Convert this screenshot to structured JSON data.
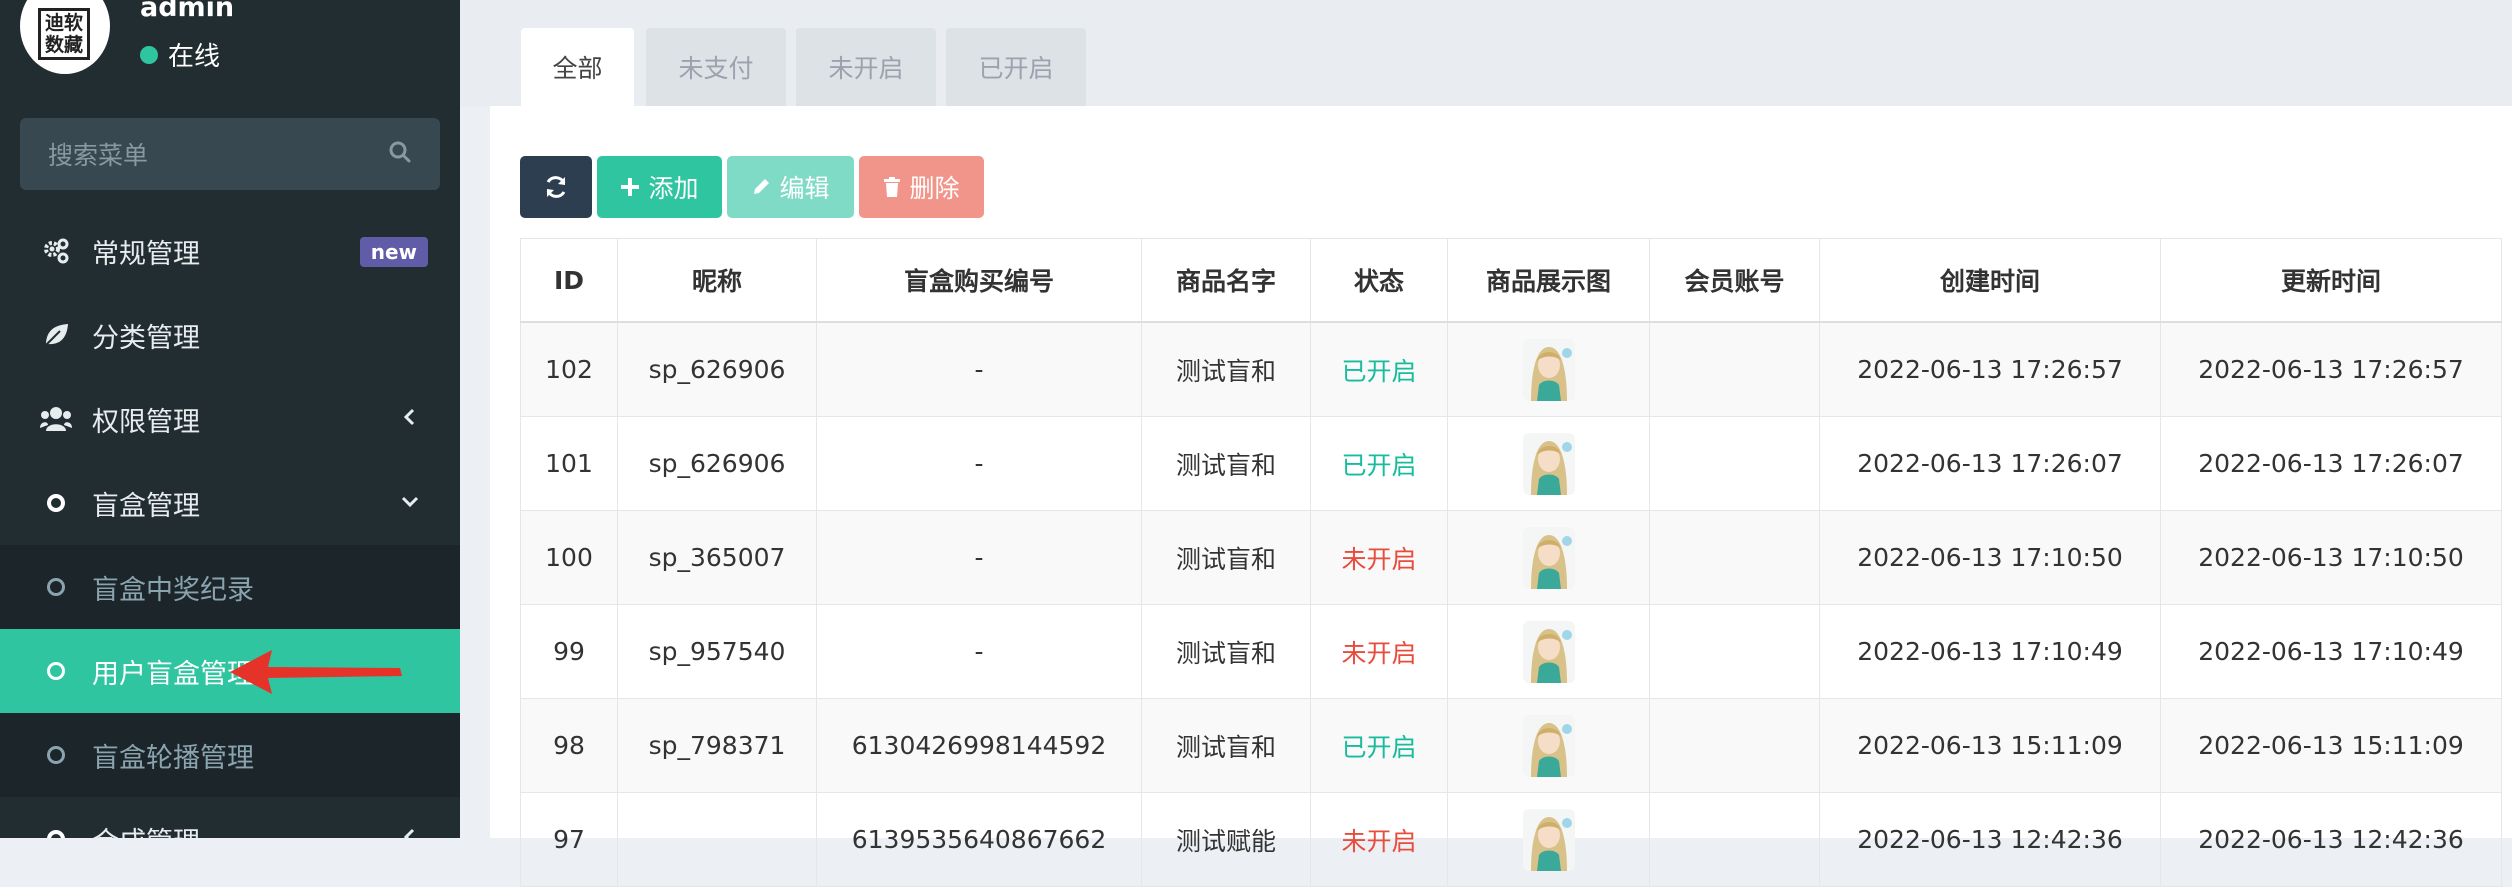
{
  "user": {
    "name": "admin",
    "status": "在线",
    "logo_text": "迪软数藏"
  },
  "search": {
    "placeholder": "搜索菜单"
  },
  "menu": [
    {
      "label": "常规管理",
      "icon": "gears-icon",
      "badge": "new"
    },
    {
      "label": "分类管理",
      "icon": "leaf-icon"
    },
    {
      "label": "权限管理",
      "icon": "users-icon",
      "chevron": "left"
    },
    {
      "label": "盲盒管理",
      "icon": "circle-icon",
      "chevron": "down"
    },
    {
      "label": "盲盒中奖纪录",
      "icon": "circle-icon",
      "sub": true
    },
    {
      "label": "用户盲盒管理",
      "icon": "circle-icon",
      "sub": true,
      "active": true
    },
    {
      "label": "盲盒轮播管理",
      "icon": "circle-icon",
      "sub": true
    },
    {
      "label": "合成管理",
      "icon": "circle-icon",
      "chevron": "left"
    }
  ],
  "tabs": [
    "全部",
    "未支付",
    "未开启",
    "已开启"
  ],
  "toolbar": {
    "add": "添加",
    "edit": "编辑",
    "delete": "删除"
  },
  "table": {
    "columns": [
      "ID",
      "昵称",
      "盲盒购买编号",
      "商品名字",
      "状态",
      "商品展示图",
      "会员账号",
      "创建时间",
      "更新时间"
    ],
    "rows": [
      {
        "id": "102",
        "nick": "sp_626906",
        "no": "-",
        "name": "测试盲和",
        "status": "已开启",
        "account": "",
        "created": "2022-06-13 17:26:57",
        "updated": "2022-06-13 17:26:57"
      },
      {
        "id": "101",
        "nick": "sp_626906",
        "no": "-",
        "name": "测试盲和",
        "status": "已开启",
        "account": "",
        "created": "2022-06-13 17:26:07",
        "updated": "2022-06-13 17:26:07"
      },
      {
        "id": "100",
        "nick": "sp_365007",
        "no": "-",
        "name": "测试盲和",
        "status": "未开启",
        "account": "",
        "created": "2022-06-13 17:10:50",
        "updated": "2022-06-13 17:10:50"
      },
      {
        "id": "99",
        "nick": "sp_957540",
        "no": "-",
        "name": "测试盲和",
        "status": "未开启",
        "account": "",
        "created": "2022-06-13 17:10:49",
        "updated": "2022-06-13 17:10:49"
      },
      {
        "id": "98",
        "nick": "sp_798371",
        "no": "6130426998144592",
        "name": "测试盲和",
        "status": "已开启",
        "account": "",
        "created": "2022-06-13 15:11:09",
        "updated": "2022-06-13 15:11:09"
      },
      {
        "id": "97",
        "nick": "",
        "no": "6139535640867662",
        "name": "测试赋能",
        "status": "未开启",
        "account": "",
        "created": "2022-06-13 12:42:36",
        "updated": "2022-06-13 12:42:36"
      }
    ]
  },
  "colors": {
    "sidebar": "#222d32",
    "accent": "#2fc5a0",
    "opened": "#18bc9c",
    "unopened": "#e74c3c",
    "badge": "#605ca8"
  }
}
